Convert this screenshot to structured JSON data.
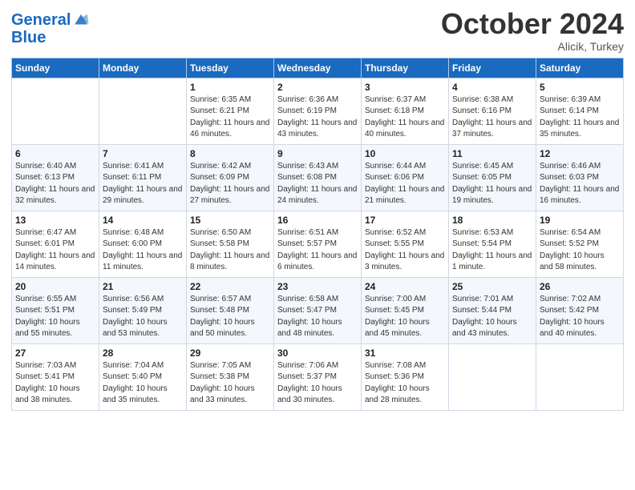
{
  "header": {
    "logo_line1": "General",
    "logo_line2": "Blue",
    "month": "October 2024",
    "location": "Alicik, Turkey"
  },
  "days_of_week": [
    "Sunday",
    "Monday",
    "Tuesday",
    "Wednesday",
    "Thursday",
    "Friday",
    "Saturday"
  ],
  "weeks": [
    [
      {
        "day": "",
        "sunrise": "",
        "sunset": "",
        "daylight": ""
      },
      {
        "day": "",
        "sunrise": "",
        "sunset": "",
        "daylight": ""
      },
      {
        "day": "1",
        "sunrise": "Sunrise: 6:35 AM",
        "sunset": "Sunset: 6:21 PM",
        "daylight": "Daylight: 11 hours and 46 minutes."
      },
      {
        "day": "2",
        "sunrise": "Sunrise: 6:36 AM",
        "sunset": "Sunset: 6:19 PM",
        "daylight": "Daylight: 11 hours and 43 minutes."
      },
      {
        "day": "3",
        "sunrise": "Sunrise: 6:37 AM",
        "sunset": "Sunset: 6:18 PM",
        "daylight": "Daylight: 11 hours and 40 minutes."
      },
      {
        "day": "4",
        "sunrise": "Sunrise: 6:38 AM",
        "sunset": "Sunset: 6:16 PM",
        "daylight": "Daylight: 11 hours and 37 minutes."
      },
      {
        "day": "5",
        "sunrise": "Sunrise: 6:39 AM",
        "sunset": "Sunset: 6:14 PM",
        "daylight": "Daylight: 11 hours and 35 minutes."
      }
    ],
    [
      {
        "day": "6",
        "sunrise": "Sunrise: 6:40 AM",
        "sunset": "Sunset: 6:13 PM",
        "daylight": "Daylight: 11 hours and 32 minutes."
      },
      {
        "day": "7",
        "sunrise": "Sunrise: 6:41 AM",
        "sunset": "Sunset: 6:11 PM",
        "daylight": "Daylight: 11 hours and 29 minutes."
      },
      {
        "day": "8",
        "sunrise": "Sunrise: 6:42 AM",
        "sunset": "Sunset: 6:09 PM",
        "daylight": "Daylight: 11 hours and 27 minutes."
      },
      {
        "day": "9",
        "sunrise": "Sunrise: 6:43 AM",
        "sunset": "Sunset: 6:08 PM",
        "daylight": "Daylight: 11 hours and 24 minutes."
      },
      {
        "day": "10",
        "sunrise": "Sunrise: 6:44 AM",
        "sunset": "Sunset: 6:06 PM",
        "daylight": "Daylight: 11 hours and 21 minutes."
      },
      {
        "day": "11",
        "sunrise": "Sunrise: 6:45 AM",
        "sunset": "Sunset: 6:05 PM",
        "daylight": "Daylight: 11 hours and 19 minutes."
      },
      {
        "day": "12",
        "sunrise": "Sunrise: 6:46 AM",
        "sunset": "Sunset: 6:03 PM",
        "daylight": "Daylight: 11 hours and 16 minutes."
      }
    ],
    [
      {
        "day": "13",
        "sunrise": "Sunrise: 6:47 AM",
        "sunset": "Sunset: 6:01 PM",
        "daylight": "Daylight: 11 hours and 14 minutes."
      },
      {
        "day": "14",
        "sunrise": "Sunrise: 6:48 AM",
        "sunset": "Sunset: 6:00 PM",
        "daylight": "Daylight: 11 hours and 11 minutes."
      },
      {
        "day": "15",
        "sunrise": "Sunrise: 6:50 AM",
        "sunset": "Sunset: 5:58 PM",
        "daylight": "Daylight: 11 hours and 8 minutes."
      },
      {
        "day": "16",
        "sunrise": "Sunrise: 6:51 AM",
        "sunset": "Sunset: 5:57 PM",
        "daylight": "Daylight: 11 hours and 6 minutes."
      },
      {
        "day": "17",
        "sunrise": "Sunrise: 6:52 AM",
        "sunset": "Sunset: 5:55 PM",
        "daylight": "Daylight: 11 hours and 3 minutes."
      },
      {
        "day": "18",
        "sunrise": "Sunrise: 6:53 AM",
        "sunset": "Sunset: 5:54 PM",
        "daylight": "Daylight: 11 hours and 1 minute."
      },
      {
        "day": "19",
        "sunrise": "Sunrise: 6:54 AM",
        "sunset": "Sunset: 5:52 PM",
        "daylight": "Daylight: 10 hours and 58 minutes."
      }
    ],
    [
      {
        "day": "20",
        "sunrise": "Sunrise: 6:55 AM",
        "sunset": "Sunset: 5:51 PM",
        "daylight": "Daylight: 10 hours and 55 minutes."
      },
      {
        "day": "21",
        "sunrise": "Sunrise: 6:56 AM",
        "sunset": "Sunset: 5:49 PM",
        "daylight": "Daylight: 10 hours and 53 minutes."
      },
      {
        "day": "22",
        "sunrise": "Sunrise: 6:57 AM",
        "sunset": "Sunset: 5:48 PM",
        "daylight": "Daylight: 10 hours and 50 minutes."
      },
      {
        "day": "23",
        "sunrise": "Sunrise: 6:58 AM",
        "sunset": "Sunset: 5:47 PM",
        "daylight": "Daylight: 10 hours and 48 minutes."
      },
      {
        "day": "24",
        "sunrise": "Sunrise: 7:00 AM",
        "sunset": "Sunset: 5:45 PM",
        "daylight": "Daylight: 10 hours and 45 minutes."
      },
      {
        "day": "25",
        "sunrise": "Sunrise: 7:01 AM",
        "sunset": "Sunset: 5:44 PM",
        "daylight": "Daylight: 10 hours and 43 minutes."
      },
      {
        "day": "26",
        "sunrise": "Sunrise: 7:02 AM",
        "sunset": "Sunset: 5:42 PM",
        "daylight": "Daylight: 10 hours and 40 minutes."
      }
    ],
    [
      {
        "day": "27",
        "sunrise": "Sunrise: 7:03 AM",
        "sunset": "Sunset: 5:41 PM",
        "daylight": "Daylight: 10 hours and 38 minutes."
      },
      {
        "day": "28",
        "sunrise": "Sunrise: 7:04 AM",
        "sunset": "Sunset: 5:40 PM",
        "daylight": "Daylight: 10 hours and 35 minutes."
      },
      {
        "day": "29",
        "sunrise": "Sunrise: 7:05 AM",
        "sunset": "Sunset: 5:38 PM",
        "daylight": "Daylight: 10 hours and 33 minutes."
      },
      {
        "day": "30",
        "sunrise": "Sunrise: 7:06 AM",
        "sunset": "Sunset: 5:37 PM",
        "daylight": "Daylight: 10 hours and 30 minutes."
      },
      {
        "day": "31",
        "sunrise": "Sunrise: 7:08 AM",
        "sunset": "Sunset: 5:36 PM",
        "daylight": "Daylight: 10 hours and 28 minutes."
      },
      {
        "day": "",
        "sunrise": "",
        "sunset": "",
        "daylight": ""
      },
      {
        "day": "",
        "sunrise": "",
        "sunset": "",
        "daylight": ""
      }
    ]
  ]
}
